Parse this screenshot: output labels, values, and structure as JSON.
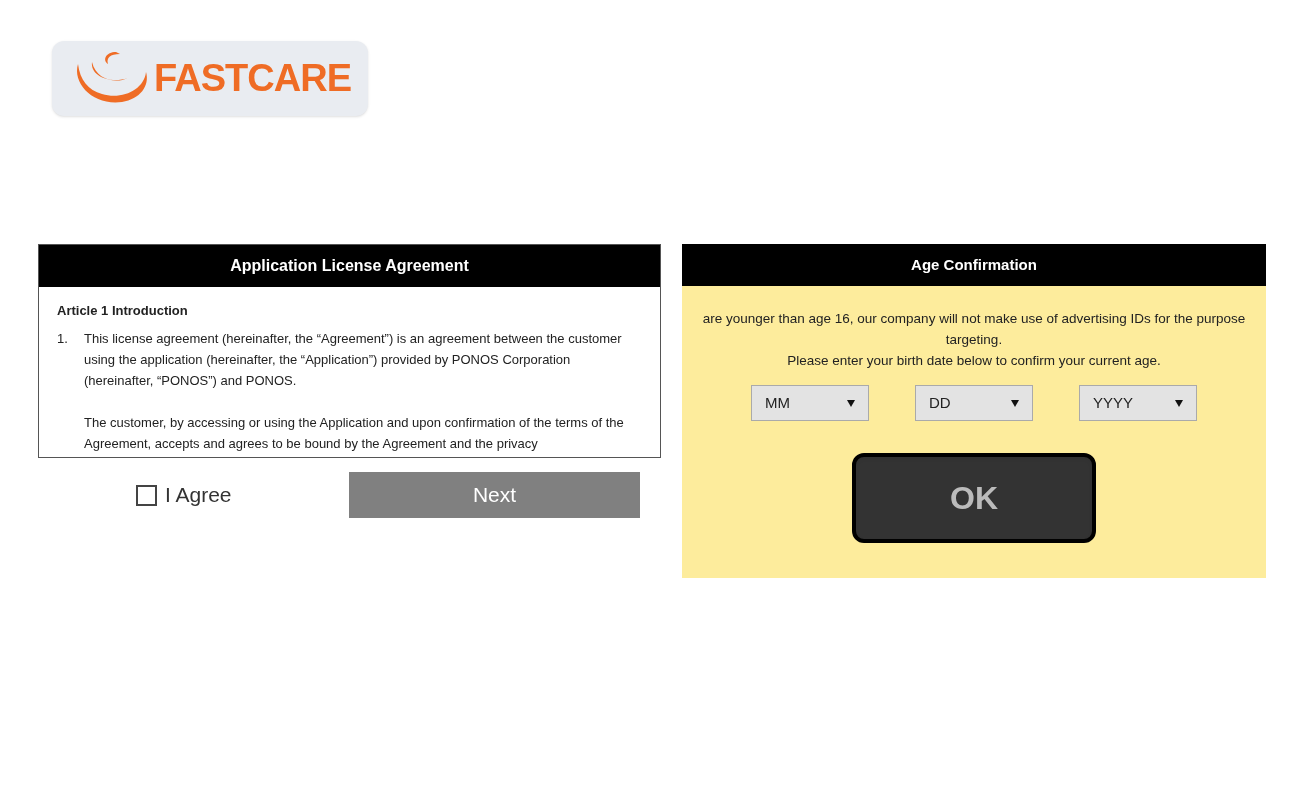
{
  "logo": {
    "text": "FASTCARE"
  },
  "agreement": {
    "title": "Application License Agreement",
    "heading": "Article 1 Introduction",
    "items": [
      {
        "number": "1.",
        "paragraphs": [
          "This license agreement (hereinafter, the “Agreement”) is an agreement between the customer using the application (hereinafter, the “Application”) provided by PONOS Corporation (hereinafter, “PONOS”) and PONOS.",
          "The customer, by accessing or using the Application and upon confirmation of the terms of the Agreement, accepts and agrees to be bound by the Agreement and the privacy"
        ]
      }
    ],
    "agree": {
      "label": "I Agree",
      "checked": false
    },
    "next": {
      "label": "Next",
      "disabled": true
    }
  },
  "age": {
    "title": "Age Confirmation",
    "lines": [
      "are younger than age 16, our company will not make use of advertising IDs for the purpose",
      "targeting.",
      "Please enter your birth date below to confirm your current age."
    ],
    "selects": [
      {
        "placeholder": "MM"
      },
      {
        "placeholder": "DD"
      },
      {
        "placeholder": "YYYY"
      }
    ],
    "ok": {
      "label": "OK"
    }
  }
}
